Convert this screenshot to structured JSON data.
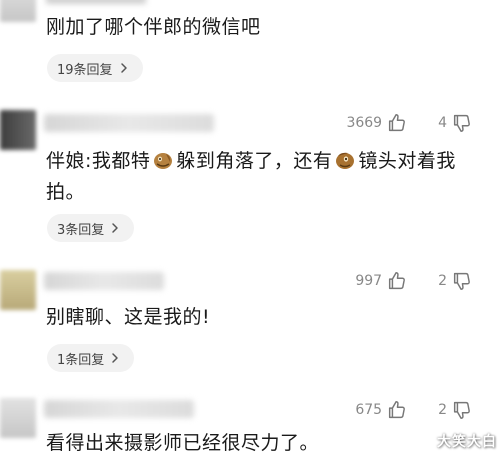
{
  "comments": [
    {
      "text": "刚加了哪个伴郎的微信吧",
      "replies": "19条回复"
    },
    {
      "likes": "3669",
      "dislikes": "4",
      "text_part1": "伴娘:我都特",
      "text_part2": "躲到角落了，还有",
      "text_part3": "镜头对着我",
      "text_line2": "拍。",
      "replies": "3条回复"
    },
    {
      "likes": "997",
      "dislikes": "2",
      "text": "别瞎聊、这是我的!",
      "replies": "1条回复"
    },
    {
      "likes": "675",
      "dislikes": "2",
      "text": "看得出来摄影师已经很尽力了。"
    }
  ],
  "watermark": "大笑大白",
  "icons": {
    "like": "thumbs-up-icon",
    "dislike": "thumbs-down-icon",
    "chevron": "chevron-right-icon",
    "emoji": "face-emoji-icon"
  },
  "colors": {
    "text": "#1a1a1a",
    "muted": "#888888",
    "pill_bg": "#f2f2f2"
  }
}
